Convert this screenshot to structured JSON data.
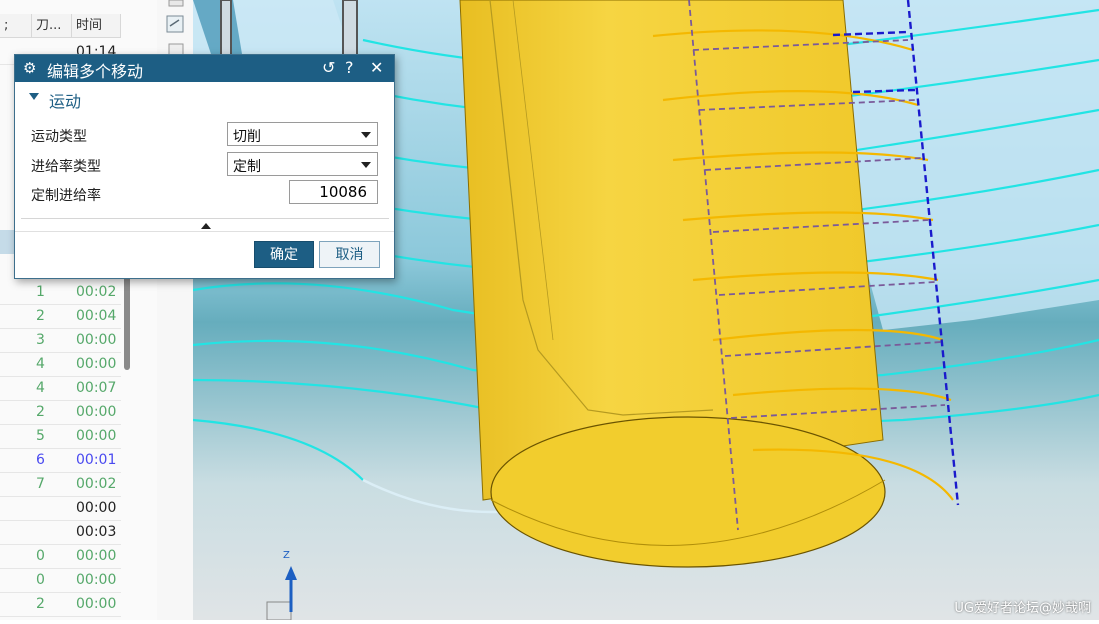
{
  "nav_table": {
    "col1_header": "刀...",
    "col2_header": "时间",
    "first_time": "01:14",
    "rows": [
      {
        "num": "1",
        "time": "00:02",
        "color": "gray"
      },
      {
        "num": "2",
        "time": "00:04",
        "color": "gray"
      },
      {
        "num": "3",
        "time": "00:00",
        "color": "gray"
      },
      {
        "num": "4",
        "time": "00:00",
        "color": "gray"
      },
      {
        "num": "4",
        "time": "00:07",
        "color": "gray"
      },
      {
        "num": "2",
        "time": "00:00",
        "color": "gray"
      },
      {
        "num": "5",
        "time": "00:00",
        "color": "gray"
      },
      {
        "num": "6",
        "time": "00:01",
        "color": "blue"
      },
      {
        "num": "7",
        "time": "00:02",
        "color": "gray"
      },
      {
        "num": "",
        "time": "00:00",
        "color": "dark"
      },
      {
        "num": "",
        "time": "00:03",
        "color": "dark"
      },
      {
        "num": "0",
        "time": "00:00",
        "color": "gray"
      },
      {
        "num": "0",
        "time": "00:00",
        "color": "gray"
      },
      {
        "num": "2",
        "time": "00:00",
        "color": "gray"
      }
    ]
  },
  "dialog": {
    "title": "编辑多个移动",
    "section": "运动",
    "motion_type_label": "运动类型",
    "motion_type_value": "切削",
    "feed_type_label": "进给率类型",
    "feed_type_value": "定制",
    "custom_feed_label": "定制进给率",
    "custom_feed_value": "10086",
    "ok": "确定",
    "cancel": "取消",
    "reset_glyph": "↺",
    "help_glyph": "?",
    "close_glyph": "✕",
    "gear_glyph": "⚙"
  },
  "viewport": {
    "axis_label": "Z",
    "watermark": "UG爱好者论坛@妙哉啊"
  },
  "colors": {
    "dialog_header": "#1d5e84",
    "tool_yellow": "#f2cb2a",
    "path_cyan": "#22e4e4",
    "path_orange": "#f4b800",
    "arrow_red": "#e53935"
  }
}
